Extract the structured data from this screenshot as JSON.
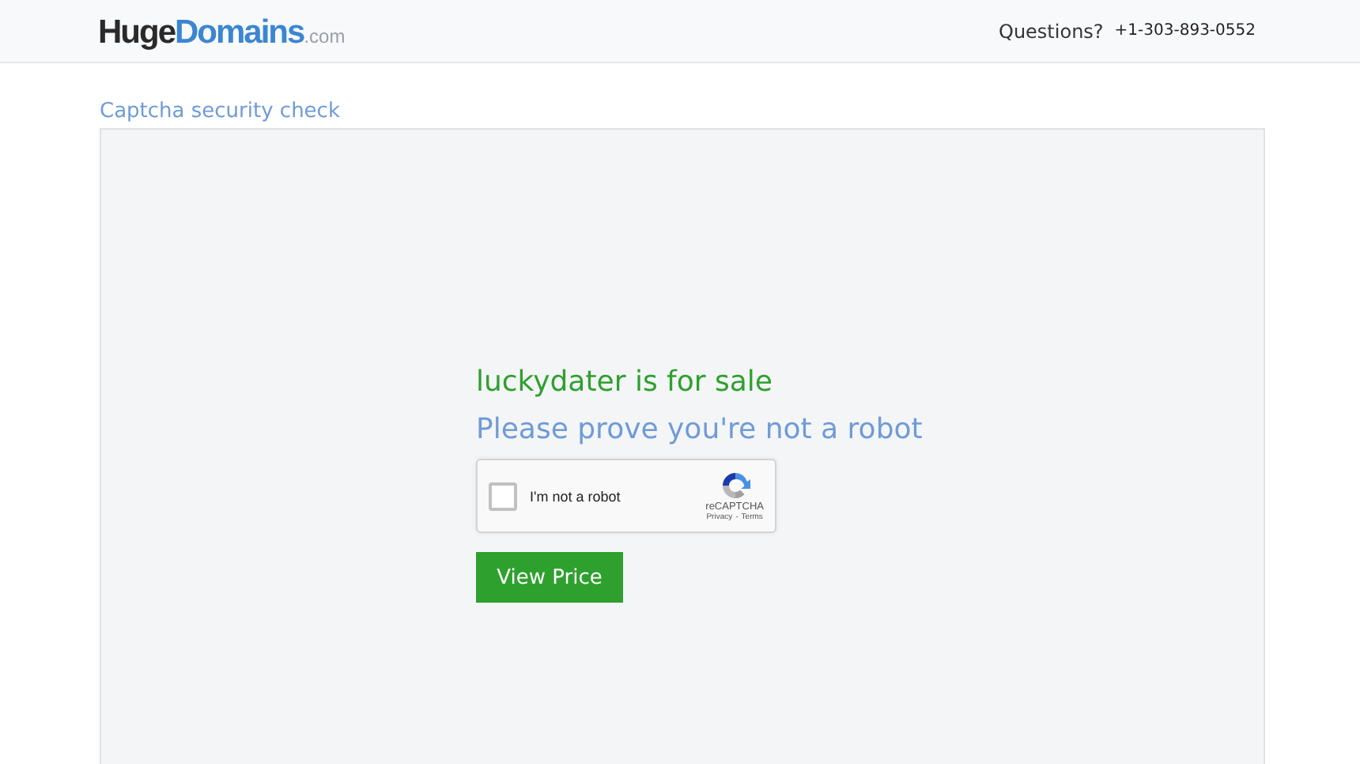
{
  "header": {
    "logo": {
      "part_1": "Huge",
      "part_2": "Domains",
      "part_3": ".com"
    },
    "questions": "Questions?",
    "phone": "+1-303-893-0552"
  },
  "breadcrumb": "Captcha security check",
  "panel": {
    "title": "luckydater is for sale",
    "subtitle": "Please prove you're not a robot",
    "captcha": {
      "checked": false,
      "label": "I'm not a robot",
      "brand": "reCAPTCHA",
      "privacy": "Privacy",
      "separator": "-",
      "terms": "Terms"
    },
    "button": "View Price"
  }
}
